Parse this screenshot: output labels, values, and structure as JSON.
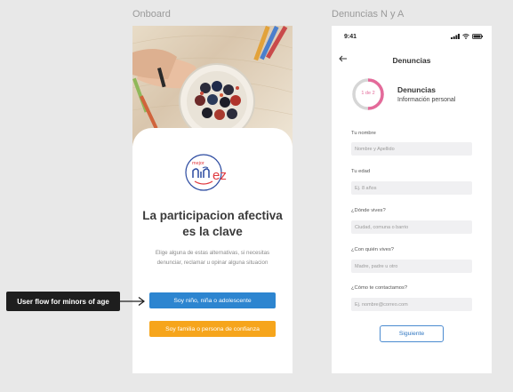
{
  "frames": {
    "onboard_label": "Onboard",
    "denuncias_label": "Denuncias N y A"
  },
  "onboard": {
    "hero": "child-drawing-with-crayons-photo",
    "logo": {
      "top_word": "mejor",
      "main_word": "niñez",
      "icon": "logo-smile"
    },
    "headline": "La participacion afectiva es la clave",
    "subtext": "Elige  alguna de estas alternativas, si necesitas denunciar, reclamar u opinar alguna situacion",
    "primary_button": "Soy niño, niña o adolescente",
    "secondary_button": "Soy familia o persona de confianza",
    "colors": {
      "primary": "#2d85d0",
      "secondary": "#f6a51c",
      "logo_blue": "#2b4aa0",
      "logo_red": "#e0383e"
    }
  },
  "annotation": {
    "label": "User flow for minors of age"
  },
  "denuncias": {
    "status_time": "9:41",
    "nav_title": "Denuncias",
    "progress": {
      "label": "1 de 2",
      "fraction": 0.5,
      "color": "#e46a9a"
    },
    "section_title": "Denuncias",
    "section_subtitle": "Información personal",
    "fields": [
      {
        "label": "Tu nombre",
        "placeholder": "Nombre y Apellido"
      },
      {
        "label": "Tu edad",
        "placeholder": "Ej. 8 años"
      },
      {
        "label": "¿Dónde vives?",
        "placeholder": "Ciudad, comuna o barrio"
      },
      {
        "label": "¿Con quién vives?",
        "placeholder": "Madre, padre u otro"
      },
      {
        "label": "¿Cómo te contactamos?",
        "placeholder": "Ej. nombre@correo.com"
      }
    ],
    "next_button": "Siguiente"
  }
}
